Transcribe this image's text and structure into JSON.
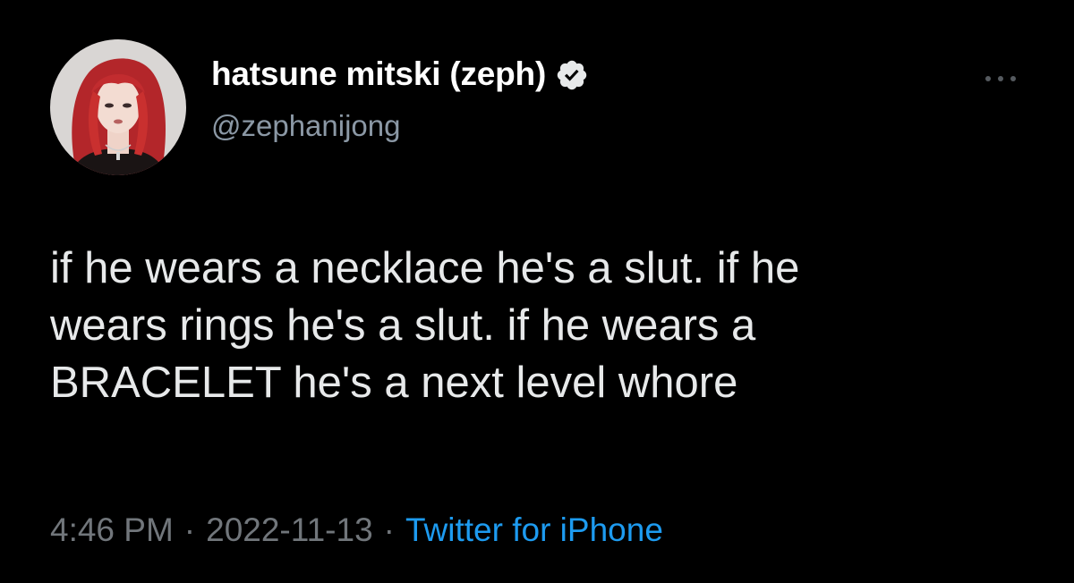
{
  "author": {
    "display_name": "hatsune mitski (zeph)",
    "handle": "@zephanijong",
    "verified": true,
    "avatar_icon": "profile-photo-red-hair"
  },
  "tweet": {
    "text_lines": [
      "if he wears a necklace he's a slut. if he",
      "wears rings he's a slut. if he wears a",
      "BRACELET he's a next level whore"
    ],
    "time": "4:46 PM",
    "separator": "·",
    "date": "2022-11-13",
    "source": "Twitter for iPhone"
  },
  "menu": {
    "icon": "more-options-icon"
  },
  "colors": {
    "background": "#000000",
    "name": "#ffffff",
    "text": "#e7e9ea",
    "muted": "#71767b",
    "accent": "#1d9bf0"
  }
}
